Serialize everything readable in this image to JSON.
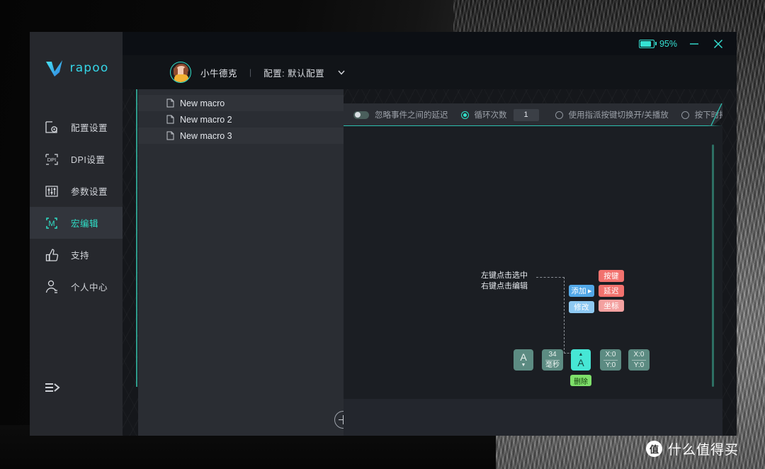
{
  "window": {
    "battery_percent": "95%",
    "minimize_label": "–",
    "close_label": "✕",
    "accent_color": "#2fe0c8"
  },
  "brand": {
    "logo_text": "rapoo",
    "logo_icon": "v-logo-icon"
  },
  "user": {
    "name": "小牛德克",
    "separator": "|",
    "profile_label": "配置: 默认配置",
    "chevron_icon": "chevron-down-icon"
  },
  "sidebar": {
    "items": [
      {
        "label": "配置设置",
        "icon": "profile-settings-icon",
        "active": false
      },
      {
        "label": "DPI设置",
        "icon": "dpi-icon",
        "active": false
      },
      {
        "label": "参数设置",
        "icon": "sliders-icon",
        "active": false
      },
      {
        "label": "宏编辑",
        "icon": "macro-m-icon",
        "active": true
      },
      {
        "label": "支持",
        "icon": "thumbs-up-icon",
        "active": false
      },
      {
        "label": "个人中心",
        "icon": "user-icon",
        "active": false
      }
    ],
    "collapse_icon": "collapse-menu-icon"
  },
  "macro_list": {
    "items": [
      {
        "name": "New macro",
        "icon": "document-icon"
      },
      {
        "name": "New macro 2",
        "icon": "document-icon"
      },
      {
        "name": "New macro 3",
        "icon": "document-icon"
      }
    ],
    "add_button_icon": "plus-circle-icon"
  },
  "editor": {
    "toolbar": {
      "ignore_delay_label": "忽略事件之间的延迟",
      "ignore_delay_on": false,
      "loop_label": "循环次数",
      "loop_selected": true,
      "loop_count": "1",
      "toggle_key_label": "使用指派按键切换开/关播放",
      "toggle_key_selected": false,
      "play_on_press_label": "按下时播放",
      "play_on_press_selected": false
    },
    "hint_line1": "左键点击选中",
    "hint_line2": "右键点击编辑",
    "context_menu": [
      {
        "label": "添加",
        "type": "add",
        "has_arrow": true
      },
      {
        "label": "修改",
        "type": "modify",
        "has_arrow": false
      }
    ],
    "submenu": [
      {
        "label": "按键",
        "type": "red"
      },
      {
        "label": "延迟",
        "type": "red"
      },
      {
        "label": "坐标",
        "type": "pink"
      }
    ],
    "steps": [
      {
        "kind": "key",
        "top": "A",
        "bottom": "▼",
        "selected": false
      },
      {
        "kind": "delay",
        "top": "34",
        "bottom": "毫秒",
        "selected": false
      },
      {
        "kind": "key",
        "top": "▲",
        "bottom": "A",
        "selected": true
      },
      {
        "kind": "coord",
        "top": "X:0",
        "bottom": "Y:0",
        "selected": false
      },
      {
        "kind": "coord",
        "top": "X:0",
        "bottom": "Y:0",
        "selected": false
      }
    ],
    "delete_label": "删除"
  },
  "watermark": {
    "logo": "值",
    "text": "什么值得买"
  }
}
